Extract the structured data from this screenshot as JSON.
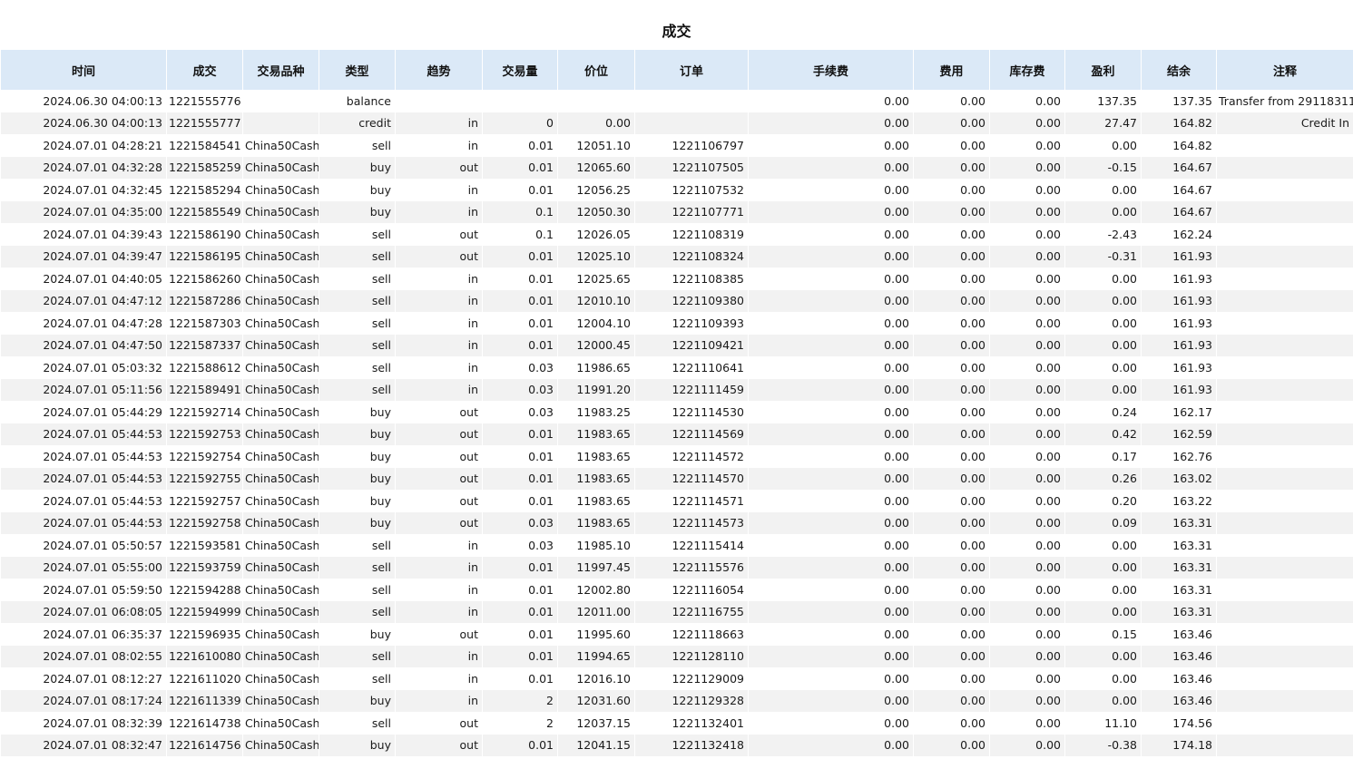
{
  "title": "成交",
  "columns": [
    "时间",
    "成交",
    "交易品种",
    "类型",
    "趋势",
    "交易量",
    "价位",
    "订单",
    "手续费",
    "费用",
    "库存费",
    "盈利",
    "结余",
    "注释"
  ],
  "rows": [
    [
      "2024.06.30 04:00:13",
      "1221555776",
      "",
      "balance",
      "",
      "",
      "",
      "",
      "0.00",
      "0.00",
      "0.00",
      "137.35",
      "137.35",
      "Transfer from 29118311"
    ],
    [
      "2024.06.30 04:00:13",
      "1221555777",
      "",
      "credit",
      "in",
      "0",
      "0.00",
      "",
      "0.00",
      "0.00",
      "0.00",
      "27.47",
      "164.82",
      "Credit In"
    ],
    [
      "2024.07.01 04:28:21",
      "1221584541",
      "China50Cash",
      "sell",
      "in",
      "0.01",
      "12051.10",
      "1221106797",
      "0.00",
      "0.00",
      "0.00",
      "0.00",
      "164.82",
      ""
    ],
    [
      "2024.07.01 04:32:28",
      "1221585259",
      "China50Cash",
      "buy",
      "out",
      "0.01",
      "12065.60",
      "1221107505",
      "0.00",
      "0.00",
      "0.00",
      "-0.15",
      "164.67",
      ""
    ],
    [
      "2024.07.01 04:32:45",
      "1221585294",
      "China50Cash",
      "buy",
      "in",
      "0.01",
      "12056.25",
      "1221107532",
      "0.00",
      "0.00",
      "0.00",
      "0.00",
      "164.67",
      ""
    ],
    [
      "2024.07.01 04:35:00",
      "1221585549",
      "China50Cash",
      "buy",
      "in",
      "0.1",
      "12050.30",
      "1221107771",
      "0.00",
      "0.00",
      "0.00",
      "0.00",
      "164.67",
      ""
    ],
    [
      "2024.07.01 04:39:43",
      "1221586190",
      "China50Cash",
      "sell",
      "out",
      "0.1",
      "12026.05",
      "1221108319",
      "0.00",
      "0.00",
      "0.00",
      "-2.43",
      "162.24",
      ""
    ],
    [
      "2024.07.01 04:39:47",
      "1221586195",
      "China50Cash",
      "sell",
      "out",
      "0.01",
      "12025.10",
      "1221108324",
      "0.00",
      "0.00",
      "0.00",
      "-0.31",
      "161.93",
      ""
    ],
    [
      "2024.07.01 04:40:05",
      "1221586260",
      "China50Cash",
      "sell",
      "in",
      "0.01",
      "12025.65",
      "1221108385",
      "0.00",
      "0.00",
      "0.00",
      "0.00",
      "161.93",
      ""
    ],
    [
      "2024.07.01 04:47:12",
      "1221587286",
      "China50Cash",
      "sell",
      "in",
      "0.01",
      "12010.10",
      "1221109380",
      "0.00",
      "0.00",
      "0.00",
      "0.00",
      "161.93",
      ""
    ],
    [
      "2024.07.01 04:47:28",
      "1221587303",
      "China50Cash",
      "sell",
      "in",
      "0.01",
      "12004.10",
      "1221109393",
      "0.00",
      "0.00",
      "0.00",
      "0.00",
      "161.93",
      ""
    ],
    [
      "2024.07.01 04:47:50",
      "1221587337",
      "China50Cash",
      "sell",
      "in",
      "0.01",
      "12000.45",
      "1221109421",
      "0.00",
      "0.00",
      "0.00",
      "0.00",
      "161.93",
      ""
    ],
    [
      "2024.07.01 05:03:32",
      "1221588612",
      "China50Cash",
      "sell",
      "in",
      "0.03",
      "11986.65",
      "1221110641",
      "0.00",
      "0.00",
      "0.00",
      "0.00",
      "161.93",
      ""
    ],
    [
      "2024.07.01 05:11:56",
      "1221589491",
      "China50Cash",
      "sell",
      "in",
      "0.03",
      "11991.20",
      "1221111459",
      "0.00",
      "0.00",
      "0.00",
      "0.00",
      "161.93",
      ""
    ],
    [
      "2024.07.01 05:44:29",
      "1221592714",
      "China50Cash",
      "buy",
      "out",
      "0.03",
      "11983.25",
      "1221114530",
      "0.00",
      "0.00",
      "0.00",
      "0.24",
      "162.17",
      ""
    ],
    [
      "2024.07.01 05:44:53",
      "1221592753",
      "China50Cash",
      "buy",
      "out",
      "0.01",
      "11983.65",
      "1221114569",
      "0.00",
      "0.00",
      "0.00",
      "0.42",
      "162.59",
      ""
    ],
    [
      "2024.07.01 05:44:53",
      "1221592754",
      "China50Cash",
      "buy",
      "out",
      "0.01",
      "11983.65",
      "1221114572",
      "0.00",
      "0.00",
      "0.00",
      "0.17",
      "162.76",
      ""
    ],
    [
      "2024.07.01 05:44:53",
      "1221592755",
      "China50Cash",
      "buy",
      "out",
      "0.01",
      "11983.65",
      "1221114570",
      "0.00",
      "0.00",
      "0.00",
      "0.26",
      "163.02",
      ""
    ],
    [
      "2024.07.01 05:44:53",
      "1221592757",
      "China50Cash",
      "buy",
      "out",
      "0.01",
      "11983.65",
      "1221114571",
      "0.00",
      "0.00",
      "0.00",
      "0.20",
      "163.22",
      ""
    ],
    [
      "2024.07.01 05:44:53",
      "1221592758",
      "China50Cash",
      "buy",
      "out",
      "0.03",
      "11983.65",
      "1221114573",
      "0.00",
      "0.00",
      "0.00",
      "0.09",
      "163.31",
      ""
    ],
    [
      "2024.07.01 05:50:57",
      "1221593581",
      "China50Cash",
      "sell",
      "in",
      "0.03",
      "11985.10",
      "1221115414",
      "0.00",
      "0.00",
      "0.00",
      "0.00",
      "163.31",
      ""
    ],
    [
      "2024.07.01 05:55:00",
      "1221593759",
      "China50Cash",
      "sell",
      "in",
      "0.01",
      "11997.45",
      "1221115576",
      "0.00",
      "0.00",
      "0.00",
      "0.00",
      "163.31",
      ""
    ],
    [
      "2024.07.01 05:59:50",
      "1221594288",
      "China50Cash",
      "sell",
      "in",
      "0.01",
      "12002.80",
      "1221116054",
      "0.00",
      "0.00",
      "0.00",
      "0.00",
      "163.31",
      ""
    ],
    [
      "2024.07.01 06:08:05",
      "1221594999",
      "China50Cash",
      "sell",
      "in",
      "0.01",
      "12011.00",
      "1221116755",
      "0.00",
      "0.00",
      "0.00",
      "0.00",
      "163.31",
      ""
    ],
    [
      "2024.07.01 06:35:37",
      "1221596935",
      "China50Cash",
      "buy",
      "out",
      "0.01",
      "11995.60",
      "1221118663",
      "0.00",
      "0.00",
      "0.00",
      "0.15",
      "163.46",
      ""
    ],
    [
      "2024.07.01 08:02:55",
      "1221610080",
      "China50Cash",
      "sell",
      "in",
      "0.01",
      "11994.65",
      "1221128110",
      "0.00",
      "0.00",
      "0.00",
      "0.00",
      "163.46",
      ""
    ],
    [
      "2024.07.01 08:12:27",
      "1221611020",
      "China50Cash",
      "sell",
      "in",
      "0.01",
      "12016.10",
      "1221129009",
      "0.00",
      "0.00",
      "0.00",
      "0.00",
      "163.46",
      ""
    ],
    [
      "2024.07.01 08:17:24",
      "1221611339",
      "China50Cash",
      "buy",
      "in",
      "2",
      "12031.60",
      "1221129328",
      "0.00",
      "0.00",
      "0.00",
      "0.00",
      "163.46",
      ""
    ],
    [
      "2024.07.01 08:32:39",
      "1221614738",
      "China50Cash",
      "sell",
      "out",
      "2",
      "12037.15",
      "1221132401",
      "0.00",
      "0.00",
      "0.00",
      "11.10",
      "174.56",
      ""
    ],
    [
      "2024.07.01 08:32:47",
      "1221614756",
      "China50Cash",
      "buy",
      "out",
      "0.01",
      "12041.15",
      "1221132418",
      "0.00",
      "0.00",
      "0.00",
      "-0.38",
      "174.18",
      ""
    ]
  ]
}
